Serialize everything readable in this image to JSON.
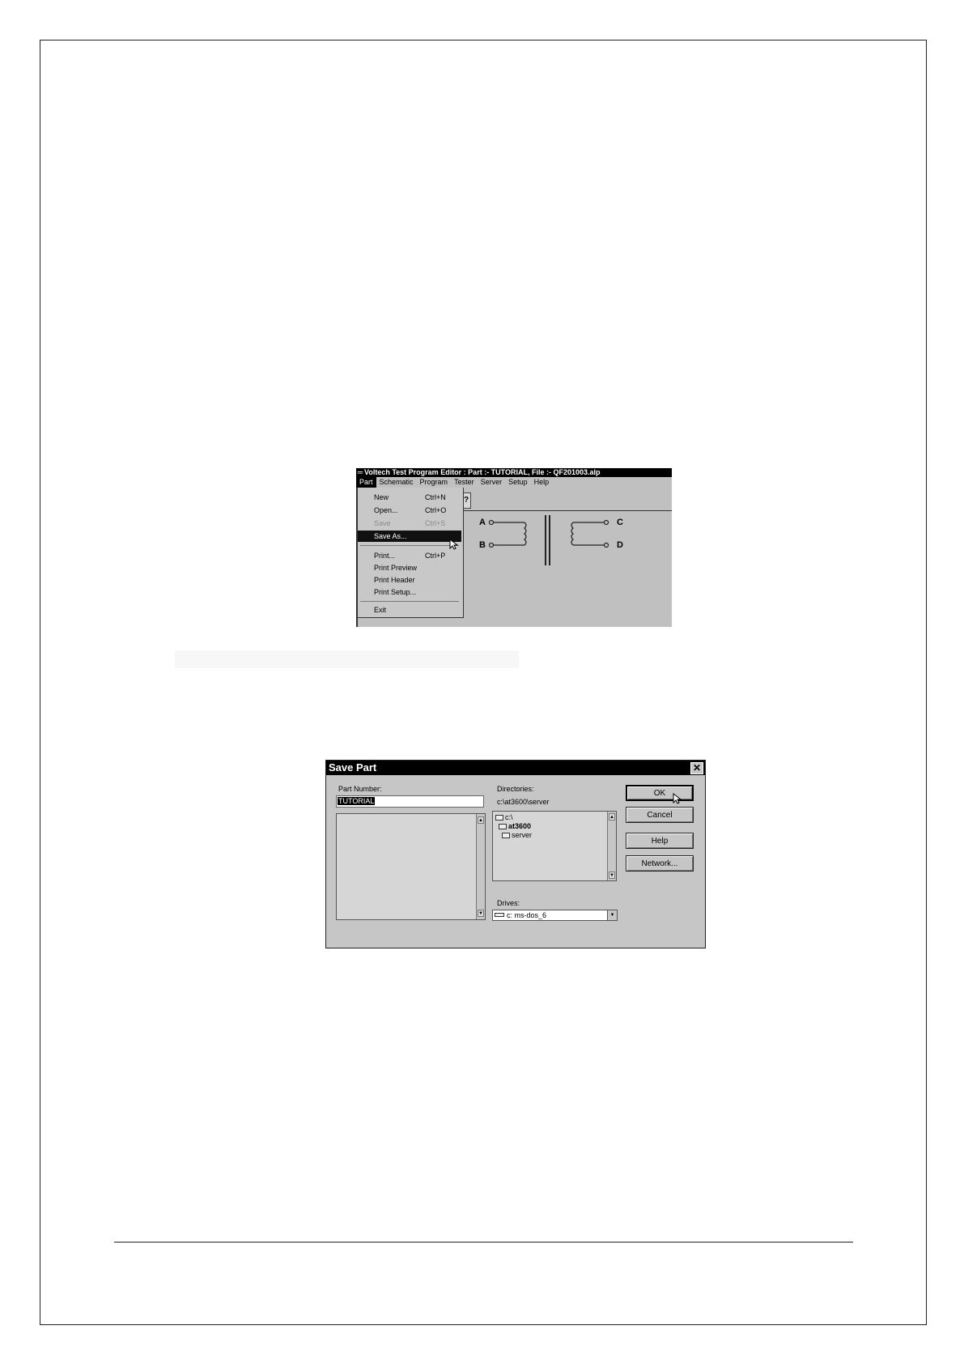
{
  "editor": {
    "title": "Voltech Test Program Editor : Part :- TUTORIAL, File :- QF201003.alp",
    "menus": [
      "Part",
      "Schematic",
      "Program",
      "Tester",
      "Server",
      "Setup",
      "Help"
    ],
    "active_menu": "Part",
    "toolbar_glyph": "?",
    "part_menu": {
      "new": {
        "label": "New",
        "shortcut": "Ctrl+N"
      },
      "open": {
        "label": "Open...",
        "shortcut": "Ctrl+O"
      },
      "save": {
        "label": "Save",
        "shortcut": "Ctrl+S"
      },
      "save_as": {
        "label": "Save As..."
      },
      "print": {
        "label": "Print...",
        "shortcut": "Ctrl+P"
      },
      "print_preview": {
        "label": "Print Preview"
      },
      "print_header": {
        "label": "Print Header"
      },
      "print_setup": {
        "label": "Print Setup..."
      },
      "exit": {
        "label": "Exit"
      }
    },
    "schematic": {
      "terminals": [
        "A",
        "B",
        "C",
        "D"
      ]
    }
  },
  "dialog": {
    "title": "Save Part",
    "close_glyph": "✕",
    "part_number_label": "Part Number:",
    "part_number_value": "TUTORIAL",
    "directories_label": "Directories:",
    "current_directory": "c:\\at3600\\server",
    "directory_tree": [
      "c:\\",
      "at3600",
      "server"
    ],
    "drives_label": "Drives:",
    "drive_value": "c: ms-dos_6",
    "buttons": {
      "ok": "OK",
      "cancel": "Cancel",
      "help": "Help",
      "network": "Network..."
    }
  }
}
